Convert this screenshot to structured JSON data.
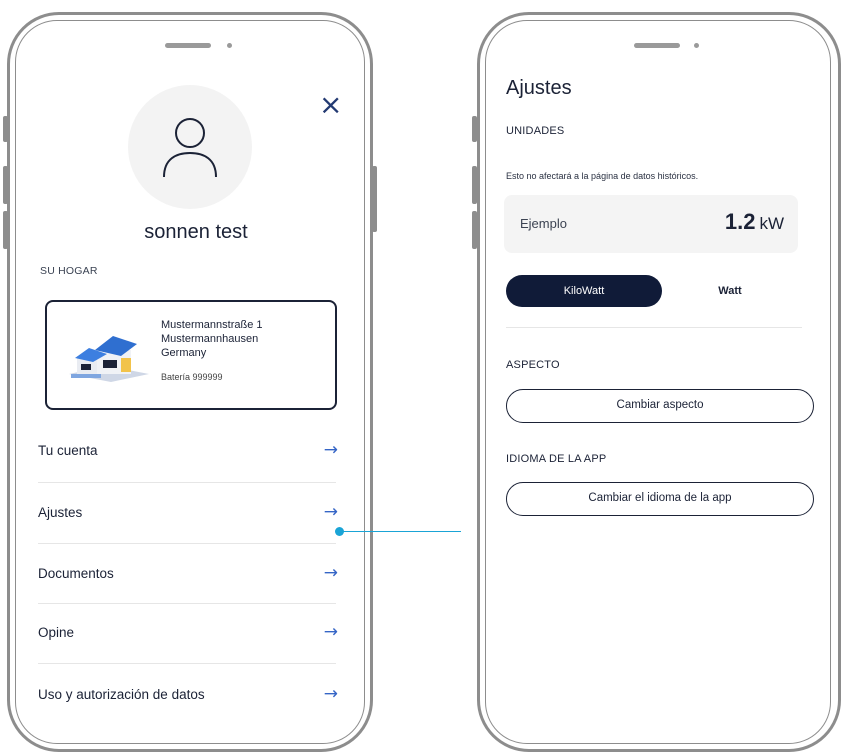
{
  "left_screen": {
    "user": {
      "name": "sonnen test"
    },
    "home": {
      "section_label": "SU HOGAR",
      "address_line1": "Mustermannstraße 1",
      "address_line2": "Mustermannhausen",
      "address_line3": "Germany",
      "battery": "Batería 999999"
    },
    "menu": [
      {
        "label": "Tu cuenta",
        "arrow": "→"
      },
      {
        "label": "Ajustes",
        "arrow": "→"
      },
      {
        "label": "Documentos",
        "arrow": "→"
      },
      {
        "label": "Opine",
        "arrow": "→"
      },
      {
        "label": "Uso y autorización de datos",
        "arrow": "→"
      }
    ],
    "close_glyph": "×"
  },
  "right_screen": {
    "title": "Ajustes",
    "units": {
      "section_label": "UNIDADES",
      "subtitle": "Esto no afectará a la página de datos históricos.",
      "example_label": "Ejemplo",
      "example_value": "1.2",
      "example_unit": "kW",
      "toggle_selected": "KiloWatt",
      "toggle_other": "Watt"
    },
    "appearance": {
      "section_label": "ASPECTO",
      "button": "Cambiar aspecto"
    },
    "language": {
      "section_label": "IDIOMA DE LA APP",
      "button": "Cambiar el idioma de la app"
    }
  },
  "colors": {
    "accent": "#1aa4d6",
    "navy": "#101b38",
    "arrow": "#3565c6",
    "frame": "#8d8d8d"
  },
  "icons": [
    "close-icon",
    "user-icon",
    "house-icon",
    "arrow-right-icon"
  ]
}
